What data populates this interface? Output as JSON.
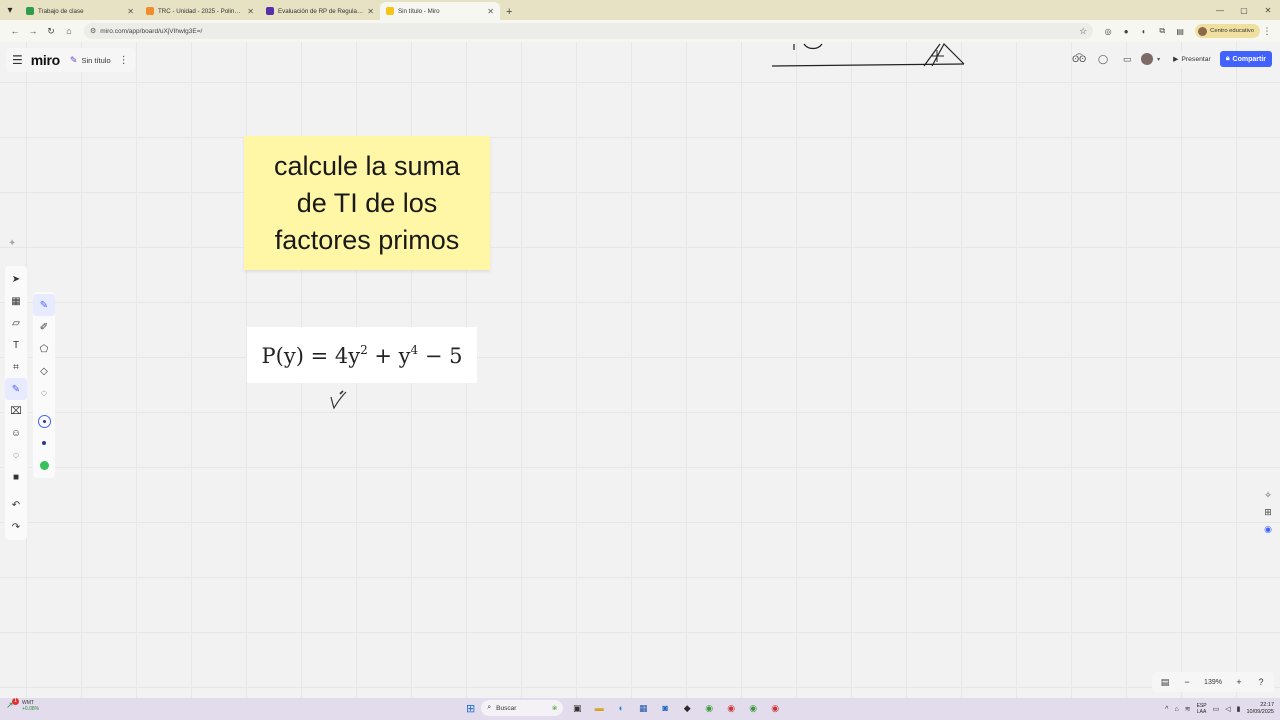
{
  "browser": {
    "tabs": [
      {
        "label": "Trabajo de clase",
        "color": "#2e9d4b",
        "active": false
      },
      {
        "label": "TRC - Unidad - 2025 - Polinomi",
        "color": "#f28b2b",
        "active": false
      },
      {
        "label": "Evaluación de RP de Regularida",
        "color": "#5a2ea6",
        "active": false
      },
      {
        "label": "Sin título - Miro",
        "color": "#f5c518",
        "active": true
      }
    ],
    "url": "miro.com/app/board/uXjVIhwlg3E=/",
    "profile_label": "Centro educativo"
  },
  "miro": {
    "logo": "miro",
    "board_title": "Sin título",
    "present_label": "Presentar",
    "share_label": "Compartir",
    "sticky_text": "calcule la suma de TI de los factores primos",
    "formula": {
      "lhs": "P(y) = 4y",
      "exp1": "2",
      "mid": " + y",
      "exp2": "4",
      "rhs": " − 5"
    },
    "zoom": "139%"
  },
  "taskbar": {
    "weather_title": "WMT",
    "weather_change": "+0.08%",
    "weather_badge": "1",
    "search_placeholder": "Buscar",
    "lang_top": "ESP",
    "lang_bottom": "LAA",
    "time": "22:17",
    "date": "10/09/2025"
  },
  "colors": {
    "accent": "#4262ff",
    "sticky": "#fff7a6"
  }
}
